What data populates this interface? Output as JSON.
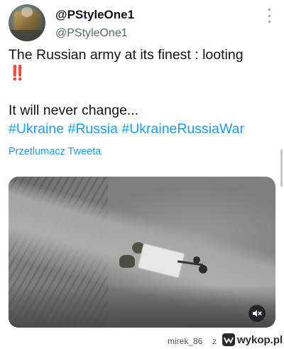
{
  "tweet": {
    "display_name": "@PStyleOne1",
    "handle": "@PStyleOne1",
    "text_line1": "The Russian army at its finest : looting",
    "text_emoji": "‼️",
    "text_line3": "It will never change...",
    "hashtags": [
      "#Ukraine",
      "#Russia",
      "#UkraineRussiaWar"
    ],
    "translate_link": "Przetlumacz Tweeta"
  },
  "media": {
    "type": "video",
    "mute_icon": "speaker-muted-icon"
  },
  "footer": {
    "user": "mirek_86",
    "connector": "z",
    "site": "wykop.pl"
  },
  "colors": {
    "accent": "#1d9bf0",
    "text": "#0f1419",
    "secondary": "#536471",
    "exclaim": "#e0142f"
  }
}
